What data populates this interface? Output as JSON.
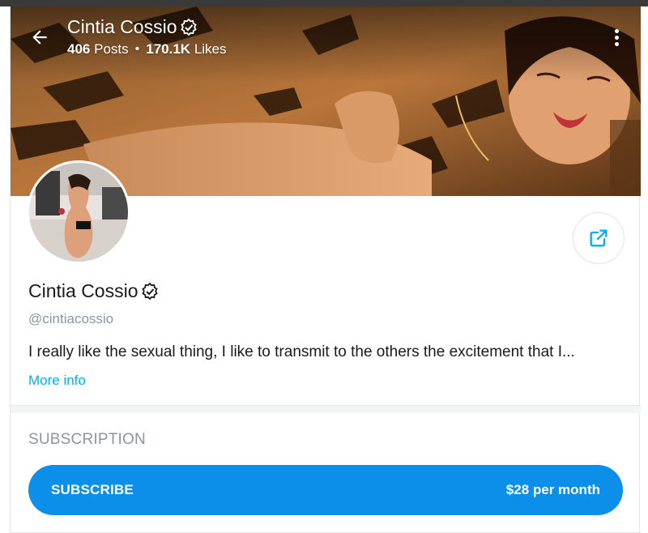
{
  "header": {
    "name": "Cintia Cossio",
    "posts_count": "406",
    "posts_label": "Posts",
    "separator": "•",
    "likes_count": "170.1K",
    "likes_label": "Likes"
  },
  "profile": {
    "name": "Cintia Cossio",
    "handle": "@cintiacossio",
    "bio": "I really like the sexual thing, I like to transmit to the others the excitement that I...",
    "more_info": "More info"
  },
  "subscription": {
    "section_title": "SUBSCRIPTION",
    "button_label": "SUBSCRIBE",
    "price": "$28 per month"
  },
  "colors": {
    "accent": "#00aff0",
    "subscribe_bg": "#0c8fe9",
    "muted_text": "#8a96a3"
  },
  "icons": {
    "back": "arrow-left-icon",
    "verified": "verified-badge-icon",
    "more": "more-vertical-icon",
    "share": "share-icon"
  }
}
